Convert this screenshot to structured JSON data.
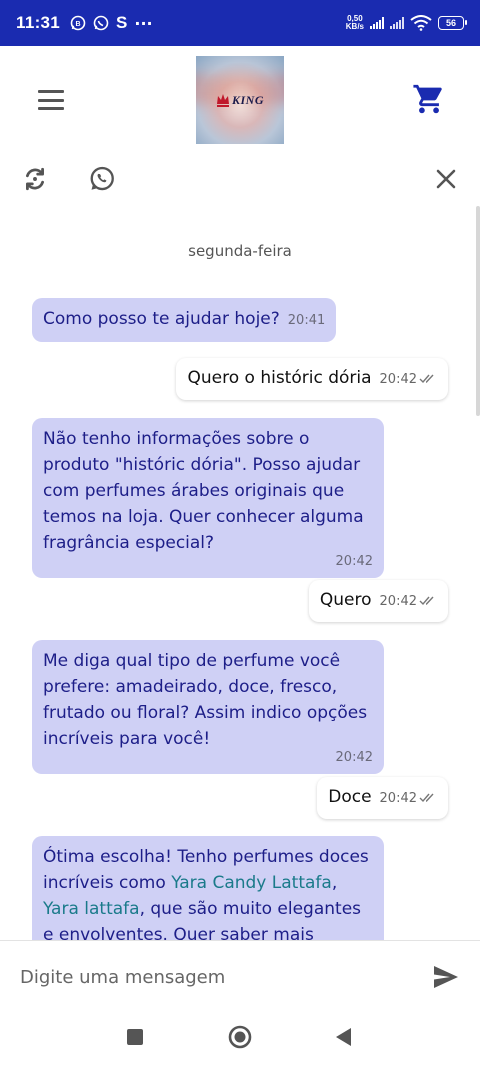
{
  "status_bar": {
    "time": "11:31",
    "left_icons": [
      "whatsapp-business-icon",
      "whatsapp-icon",
      "s-app-icon",
      "more-dots-icon"
    ],
    "more_glyph": "···",
    "s_glyph": "S",
    "net_speed_value": "0,50",
    "net_speed_unit": "KB/s",
    "battery": "56"
  },
  "header": {
    "logo_text": "KING",
    "accent_color": "#1a2bb0"
  },
  "chat": {
    "day_separator": "segunda-feira",
    "messages": [
      {
        "from": "bot",
        "text": "Como posso te ajudar hoje?",
        "time": "20:41"
      },
      {
        "from": "user",
        "text": "Quero o históric dória",
        "time": "20:42"
      },
      {
        "from": "bot",
        "text": "Não tenho informações sobre o produto \"históric dória\". Posso ajudar com perfumes árabes originais que temos na loja. Quer conhecer alguma fragrância especial?",
        "time": "20:42"
      },
      {
        "from": "user",
        "text": "Quero",
        "time": "20:42"
      },
      {
        "from": "bot",
        "text": "Me diga qual tipo de perfume você prefere: amadeirado, doce, fresco, frutado ou floral? Assim indico opções incríveis para você!",
        "time": "20:42"
      },
      {
        "from": "user",
        "text": "Doce",
        "time": "20:42"
      },
      {
        "from": "bot",
        "text_before": "Ótima escolha! Tenho perfumes doces incríveis como ",
        "link1": "Yara Candy Lattafa",
        "text_mid": ", ",
        "link2": "Yara lattafa",
        "text_after": ", que são muito elegantes e envolventes. Quer saber mais detalhes"
      }
    ]
  },
  "composer": {
    "placeholder": "Digite uma mensagem"
  },
  "colors": {
    "bot_bubble": "#cfd0f5",
    "bot_text": "#1d1e88",
    "link": "#1a7a8a",
    "status_bar": "#1a2bb0"
  }
}
